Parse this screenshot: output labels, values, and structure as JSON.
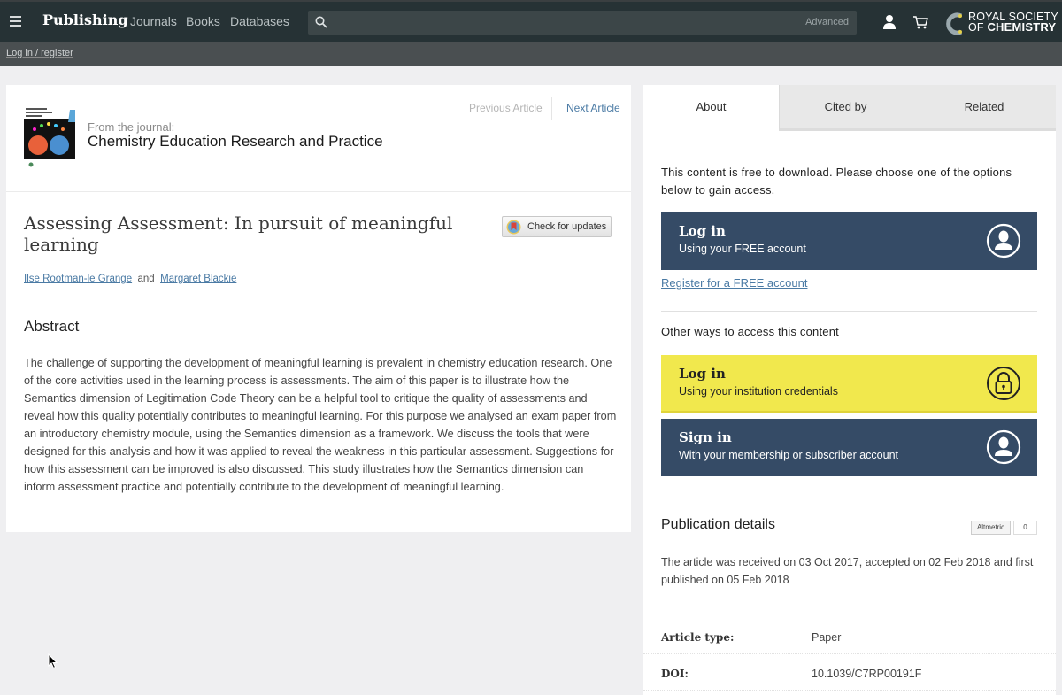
{
  "topbar": {
    "brand": "Publishing",
    "nav": [
      "Journals",
      "Books",
      "Databases"
    ],
    "search": {
      "value": "",
      "placeholder": "",
      "advanced_label": "Advanced"
    },
    "logo": {
      "line1": "ROYAL SOCIETY",
      "line2_prefix": "OF ",
      "line2_bold": "CHEMISTRY"
    }
  },
  "subbar": {
    "login_register": "Log in / register"
  },
  "article": {
    "from_journal_label": "From the journal:",
    "journal_name": "Chemistry Education Research and Practice",
    "prev_article": "Previous Article",
    "next_article": "Next Article",
    "check_updates": "Check for updates",
    "title": "Assessing Assessment: In pursuit of meaningful learning",
    "authors": [
      "Ilse Rootman-le Grange",
      "Margaret Blackie"
    ],
    "authors_conjunction": "and",
    "abstract_heading": "Abstract",
    "abstract": "The challenge of supporting the development of meaningful learning is prevalent in chemistry education research. One of the core activities used in the learning process is assessments. The aim of this paper is to illustrate how the Semantics dimension of Legitimation Code Theory can be a helpful tool to critique the quality of assessments and reveal how this quality potentially contributes to meaningful learning. For this purpose we analysed an exam paper from an introductory chemistry module, using the Semantics dimension as a framework. We discuss the tools that were designed for this analysis and how it was applied to reveal the weakness in this particular assessment. Suggestions for how this assessment can be improved is also discussed. This study illustrates how the Semantics dimension can inform assessment practice and potentially contribute to the development of meaningful learning."
  },
  "panel": {
    "tabs": [
      {
        "label": "About",
        "active": true
      },
      {
        "label": "Cited by",
        "active": false
      },
      {
        "label": "Related",
        "active": false
      }
    ],
    "free_text": "This content is free to download. Please choose one of the options below to gain access.",
    "login_free": {
      "title": "Log in",
      "subtitle": "Using your FREE account"
    },
    "register_link": "Register for a FREE account",
    "other_ways": "Other ways to access this content",
    "login_institution": {
      "title": "Log in",
      "subtitle": "Using your institution credentials"
    },
    "sign_in": {
      "title": "Sign in",
      "subtitle": "With your membership or subscriber account"
    },
    "publication_heading": "Publication details",
    "altmetric": {
      "label": "Altmetric",
      "count": "0"
    },
    "publication_text": "The article was received on 03 Oct 2017, accepted on 02 Feb 2018 and first published on 05 Feb 2018",
    "details": [
      {
        "label": "Article type:",
        "value": "Paper"
      },
      {
        "label": "DOI:",
        "value": "10.1039/C7RP00191F"
      }
    ]
  },
  "colors": {
    "topbar": "#263235",
    "dark_button": "#354b66",
    "yellow_button": "#f1e84d",
    "link": "#4a7aa4"
  }
}
